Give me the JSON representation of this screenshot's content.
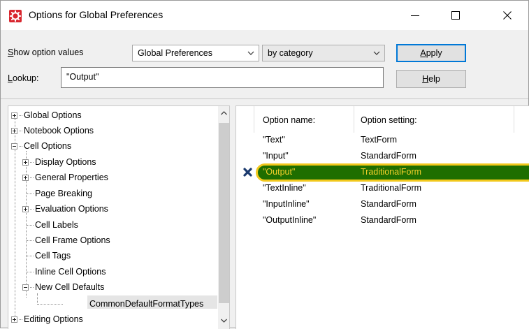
{
  "window": {
    "title": "Options for Global Preferences",
    "minimize_icon": "minimize-icon",
    "maximize_icon": "maximize-icon",
    "close_icon": "close-icon"
  },
  "controls": {
    "show_label_prefix": "S",
    "show_label_rest": "how option values",
    "scope_value": "Global Preferences",
    "view_value": "by category",
    "lookup_label_prefix": "L",
    "lookup_label_rest": "ookup:",
    "lookup_value": "\"Output\"",
    "apply_prefix": "A",
    "apply_rest": "pply",
    "help_prefix": "H",
    "help_rest": "elp"
  },
  "tree": {
    "items": [
      {
        "label": "Global Options"
      },
      {
        "label": "Notebook Options"
      },
      {
        "label": "Cell Options"
      },
      {
        "label": "Display Options"
      },
      {
        "label": "General Properties"
      },
      {
        "label": "Page Breaking"
      },
      {
        "label": "Evaluation Options"
      },
      {
        "label": "Cell Labels"
      },
      {
        "label": "Cell Frame Options"
      },
      {
        "label": "Cell Tags"
      },
      {
        "label": "Inline Cell Options"
      },
      {
        "label": "New Cell Defaults"
      },
      {
        "label": "CommonDefaultFormatTypes"
      },
      {
        "label": "Editing Options"
      }
    ]
  },
  "options": {
    "header_name": "Option name:",
    "header_setting": "Option setting:",
    "highlight_color": "#1e6e00",
    "highlight_text_color": "#f3cf2a",
    "rows": [
      {
        "name": "\"Text\"",
        "setting": "TextForm"
      },
      {
        "name": "\"Input\"",
        "setting": "StandardForm"
      },
      {
        "name": "\"Output\"",
        "setting": "TraditionalForm"
      },
      {
        "name": "\"TextInline\"",
        "setting": "TraditionalForm"
      },
      {
        "name": "\"InputInline\"",
        "setting": "StandardForm"
      },
      {
        "name": "\"OutputInline\"",
        "setting": "StandardForm"
      }
    ]
  }
}
